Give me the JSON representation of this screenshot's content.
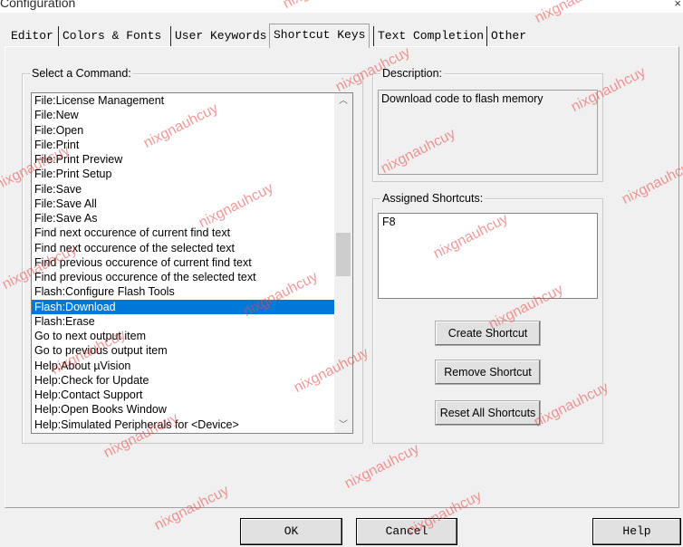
{
  "window": {
    "title": "Configuration",
    "close_glyph": "×"
  },
  "tabs": [
    "Editor",
    "Colors & Fonts",
    "User Keywords",
    "Shortcut Keys",
    "Text Completion",
    "Other"
  ],
  "active_tab": "Shortcut Keys",
  "select_command": {
    "label": "Select a Command:",
    "items": [
      "File:License Management",
      "File:New",
      "File:Open",
      "File:Print",
      "File:Print Preview",
      "File:Print Setup",
      "File:Save",
      "File:Save All",
      "File:Save As",
      "Find next occurence of current find text",
      "Find next occurence of the selected text",
      "Find previous occurence of current find text",
      "Find previous occurence of the selected text",
      "Flash:Configure Flash Tools",
      "Flash:Download",
      "Flash:Erase",
      "Go to next output item",
      "Go to previous output item",
      "Help:About µVision",
      "Help:Check for Update",
      "Help:Contact Support",
      "Help:Open Books Window",
      "Help:Simulated Peripherals for <Device>"
    ],
    "selected": "Flash:Download",
    "scroll_up_icon": "chevron-up-icon",
    "scroll_down_icon": "chevron-down-icon"
  },
  "description": {
    "label": "Description:",
    "text": "Download code to flash memory"
  },
  "assigned_shortcuts": {
    "label": "Assigned Shortcuts:",
    "items": [
      "F8"
    ]
  },
  "buttons": {
    "create": "Create Shortcut",
    "remove": "Remove Shortcut",
    "reset": "Reset All Shortcuts"
  },
  "dialog_buttons": {
    "ok": "OK",
    "cancel": "Cancel",
    "help": "Help"
  },
  "watermark": "nixgnauhcuy"
}
